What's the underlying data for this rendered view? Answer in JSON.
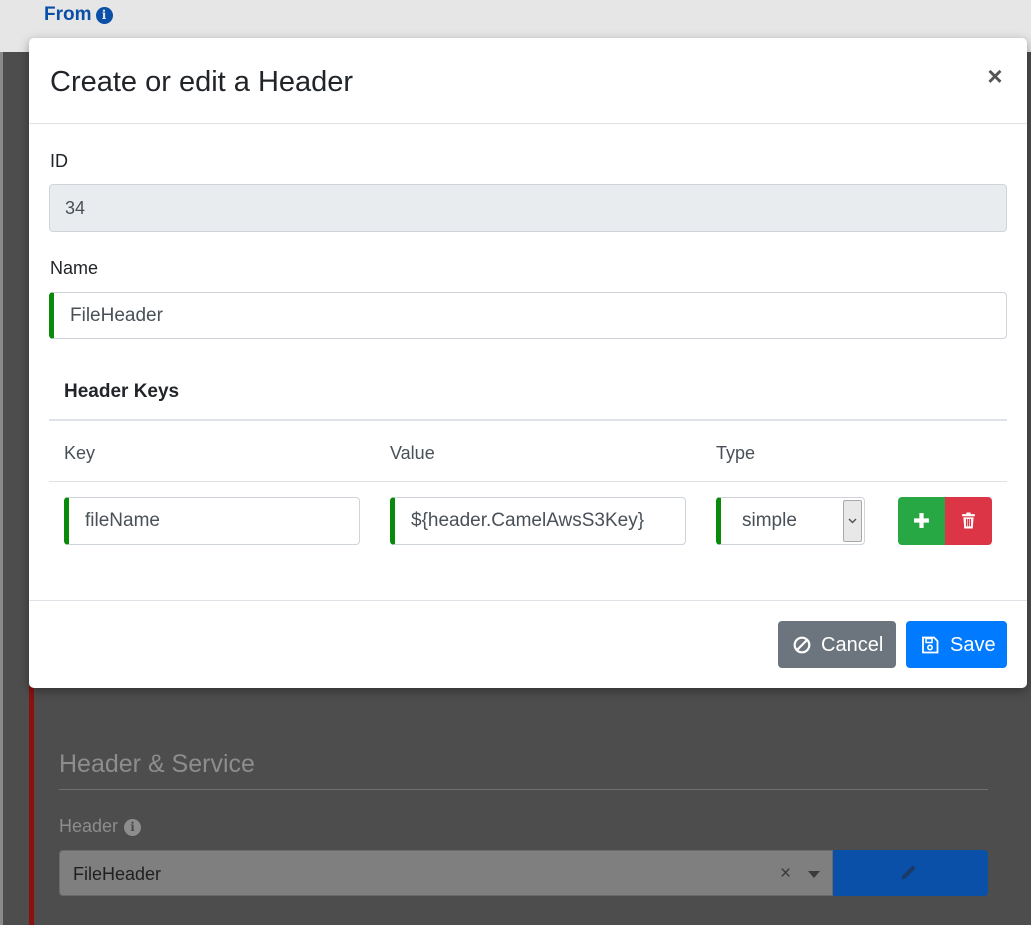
{
  "background": {
    "top_title": "From",
    "section_title": "Header & Service",
    "header_label": "Header",
    "header_select_value": "FileHeader",
    "clear_glyph": "×"
  },
  "modal": {
    "title": "Create or edit a Header",
    "close_glyph": "×",
    "id_label": "ID",
    "id_value": "34",
    "name_label": "Name",
    "name_value": "FileHeader",
    "header_keys_title": "Header Keys",
    "columns": {
      "key": "Key",
      "value": "Value",
      "type": "Type"
    },
    "rows": [
      {
        "key": "fileName",
        "value": "${header.CamelAwsS3Key}",
        "type": "simple"
      }
    ],
    "cancel_label": "Cancel",
    "save_label": "Save"
  },
  "colors": {
    "valid_border": "#0a8a0a",
    "add_button": "#28a745",
    "delete_button": "#dc3545",
    "save_button": "#007bff",
    "cancel_button": "#6c757d"
  },
  "icons": {
    "close": "close-icon",
    "info": "info-icon",
    "add": "plus-icon",
    "delete": "trash-icon",
    "cancel": "ban-icon",
    "save": "floppy-disk-icon",
    "edit": "pencil-icon",
    "select_arrow": "chevron-down-icon",
    "clear": "clear-icon"
  }
}
